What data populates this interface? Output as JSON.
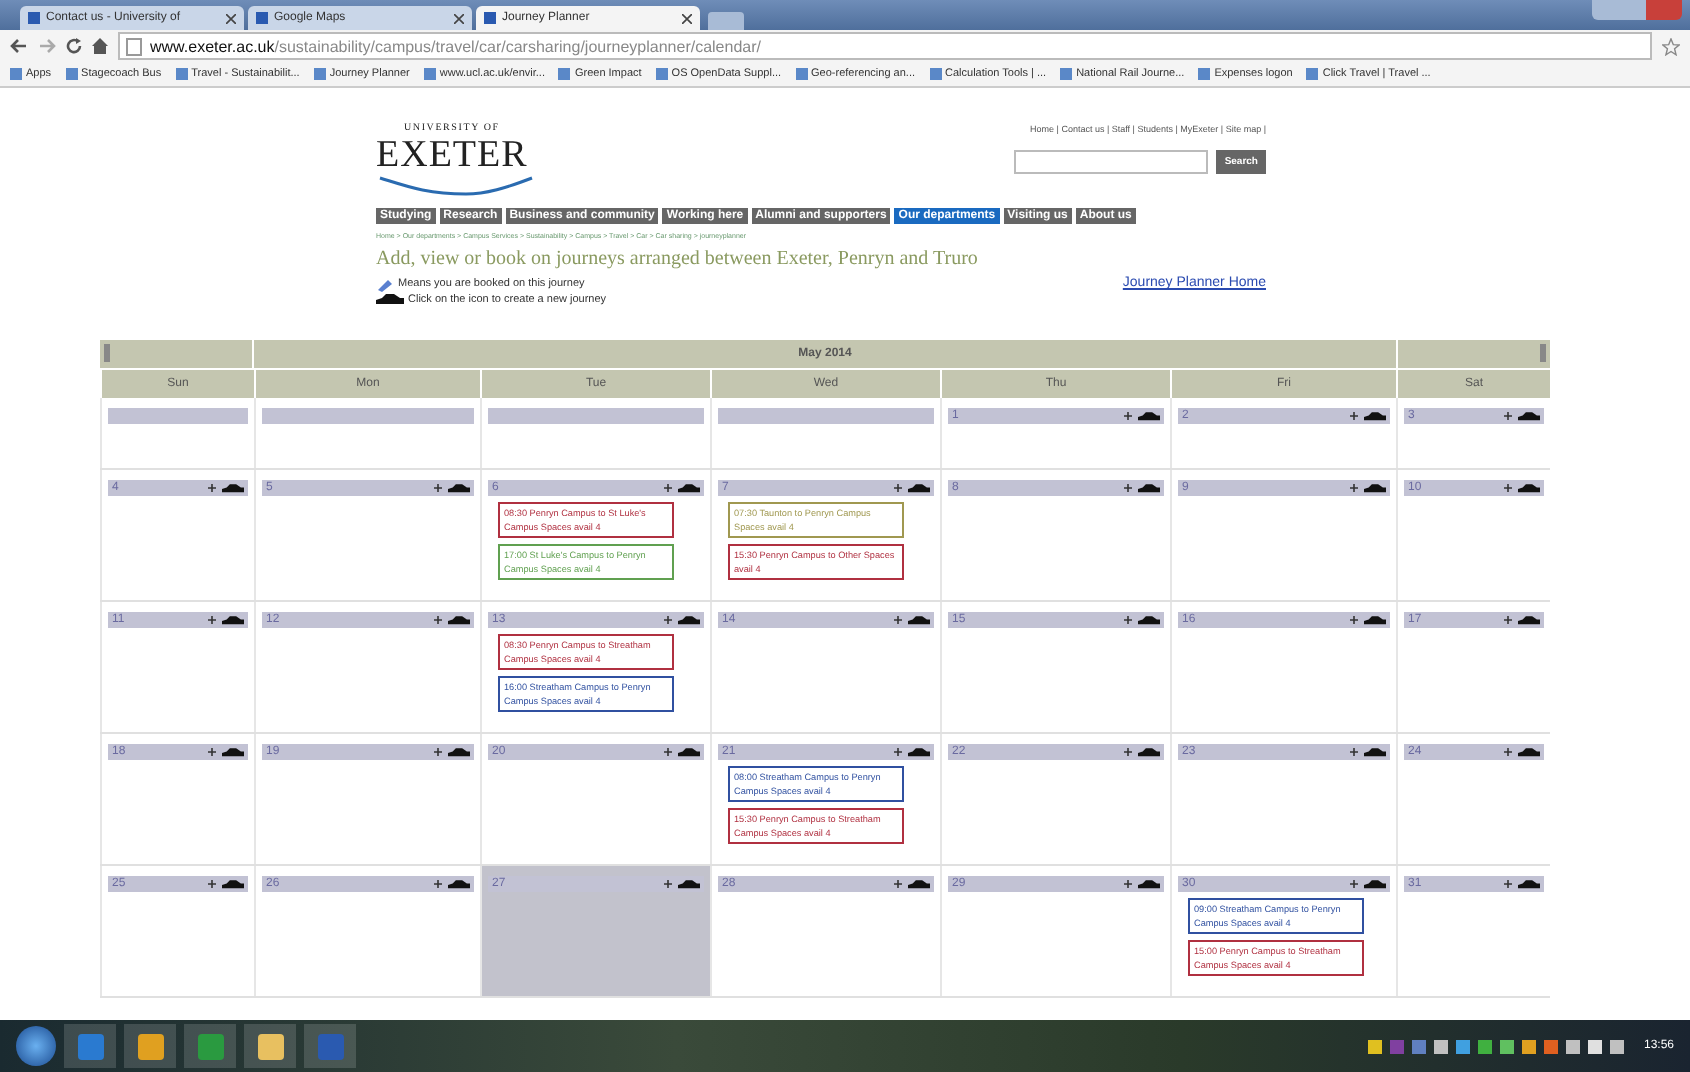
{
  "browser": {
    "tabs": [
      {
        "label": "Contact us - University of",
        "selected": false
      },
      {
        "label": "Google Maps",
        "selected": false
      },
      {
        "label": "Journey Planner",
        "selected": true
      }
    ],
    "url": {
      "host": "www.exeter.ac.uk",
      "path": "/sustainability/campus/travel/car/carsharing/journeyplanner/calendar/"
    },
    "bookmarks": [
      "Apps",
      "Stagecoach Bus",
      "Travel - Sustainabilit...",
      "Journey Planner",
      "www.ucl.ac.uk/envir...",
      "Green Impact",
      "OS OpenData Suppl...",
      "Geo-referencing an...",
      "Calculation Tools | ...",
      "National Rail Journe...",
      "Expenses logon",
      "Click Travel | Travel ..."
    ]
  },
  "header": {
    "logo_small": "UNIVERSITY OF",
    "logo_big": "EXETER",
    "top_links": "Home | Contact us | Staff | Students | MyExeter | Site map |",
    "search_button": "Search"
  },
  "nav": [
    {
      "label": "Studying",
      "selected": false
    },
    {
      "label": "Research",
      "selected": false
    },
    {
      "label": "Business and community",
      "selected": false
    },
    {
      "label": "Working here",
      "selected": false
    },
    {
      "label": "Alumni and supporters",
      "selected": false
    },
    {
      "label": "Our departments",
      "selected": true
    },
    {
      "label": "Visiting us",
      "selected": false
    },
    {
      "label": "About us",
      "selected": false
    }
  ],
  "breadcrumb": "Home > Our departments > Campus Services > Sustainability > Campus > Travel > Car > Car sharing > journeyplanner",
  "heading": "Add, view or book on journeys arranged between Exeter, Penryn and Truro",
  "legend": [
    "Means you are booked on this journey",
    "Click on the icon to create a new journey"
  ],
  "home_link": "Journey Planner Home",
  "calendar": {
    "month": "May 2014",
    "weekdays": [
      "Sun",
      "Mon",
      "Tue",
      "Wed",
      "Thu",
      "Fri",
      "Sat"
    ],
    "weeks": [
      [
        {
          "kind": "empty"
        },
        {
          "kind": "empty"
        },
        {
          "kind": "empty"
        },
        {
          "kind": "empty"
        },
        {
          "kind": "day",
          "day": "1",
          "selected": false
        },
        {
          "kind": "day",
          "day": "2",
          "selected": false
        },
        {
          "kind": "day",
          "day": "3",
          "selected": false
        }
      ],
      [
        {
          "kind": "day",
          "day": "4",
          "selected": false
        },
        {
          "kind": "day",
          "day": "5",
          "selected": false
        },
        {
          "kind": "day",
          "day": "6",
          "selected": false,
          "events": [
            {
              "text": "08:30 Penryn Campus to St Luke's Campus Spaces avail 4",
              "color": "#b03040"
            },
            {
              "text": "17:00 St Luke's Campus to Penryn Campus Spaces avail 4",
              "color": "#60a050"
            }
          ]
        },
        {
          "kind": "day",
          "day": "7",
          "selected": false,
          "events": [
            {
              "text": "07:30 Taunton to Penryn Campus Spaces avail 4",
              "color": "#a09850"
            },
            {
              "text": "15:30 Penryn Campus to Other Spaces avail 4",
              "color": "#b03040"
            }
          ]
        },
        {
          "kind": "day",
          "day": "8",
          "selected": false
        },
        {
          "kind": "day",
          "day": "9",
          "selected": false
        },
        {
          "kind": "day",
          "day": "10",
          "selected": false
        }
      ],
      [
        {
          "kind": "day",
          "day": "11",
          "selected": false
        },
        {
          "kind": "day",
          "day": "12",
          "selected": false
        },
        {
          "kind": "day",
          "day": "13",
          "selected": false,
          "events": [
            {
              "text": "08:30 Penryn Campus to Streatham Campus Spaces avail 4",
              "color": "#b03040"
            },
            {
              "text": "16:00 Streatham Campus to Penryn Campus Spaces avail 4",
              "color": "#3050a0"
            }
          ]
        },
        {
          "kind": "day",
          "day": "14",
          "selected": false
        },
        {
          "kind": "day",
          "day": "15",
          "selected": false
        },
        {
          "kind": "day",
          "day": "16",
          "selected": false
        },
        {
          "kind": "day",
          "day": "17",
          "selected": false
        }
      ],
      [
        {
          "kind": "day",
          "day": "18",
          "selected": false
        },
        {
          "kind": "day",
          "day": "19",
          "selected": false
        },
        {
          "kind": "day",
          "day": "20",
          "selected": false
        },
        {
          "kind": "day",
          "day": "21",
          "selected": false,
          "events": [
            {
              "text": "08:00 Streatham Campus to Penryn Campus Spaces avail 4",
              "color": "#3050a0"
            },
            {
              "text": "15:30 Penryn Campus to Streatham Campus Spaces avail 4",
              "color": "#b03040"
            }
          ]
        },
        {
          "kind": "day",
          "day": "22",
          "selected": false
        },
        {
          "kind": "day",
          "day": "23",
          "selected": false
        },
        {
          "kind": "day",
          "day": "24",
          "selected": false
        }
      ],
      [
        {
          "kind": "day",
          "day": "25",
          "selected": false
        },
        {
          "kind": "day",
          "day": "26",
          "selected": false
        },
        {
          "kind": "day",
          "day": "27",
          "selected": true
        },
        {
          "kind": "day",
          "day": "28",
          "selected": false
        },
        {
          "kind": "day",
          "day": "29",
          "selected": false
        },
        {
          "kind": "day",
          "day": "30",
          "selected": false,
          "events": [
            {
              "text": "09:00 Streatham Campus to Penryn Campus Spaces avail 4",
              "color": "#3050a0"
            },
            {
              "text": "15:00 Penryn Campus to Streatham Campus Spaces avail 4",
              "color": "#b03040"
            }
          ]
        },
        {
          "kind": "day",
          "day": "31",
          "selected": false
        }
      ]
    ]
  },
  "taskbar": {
    "clock": "13:56"
  }
}
